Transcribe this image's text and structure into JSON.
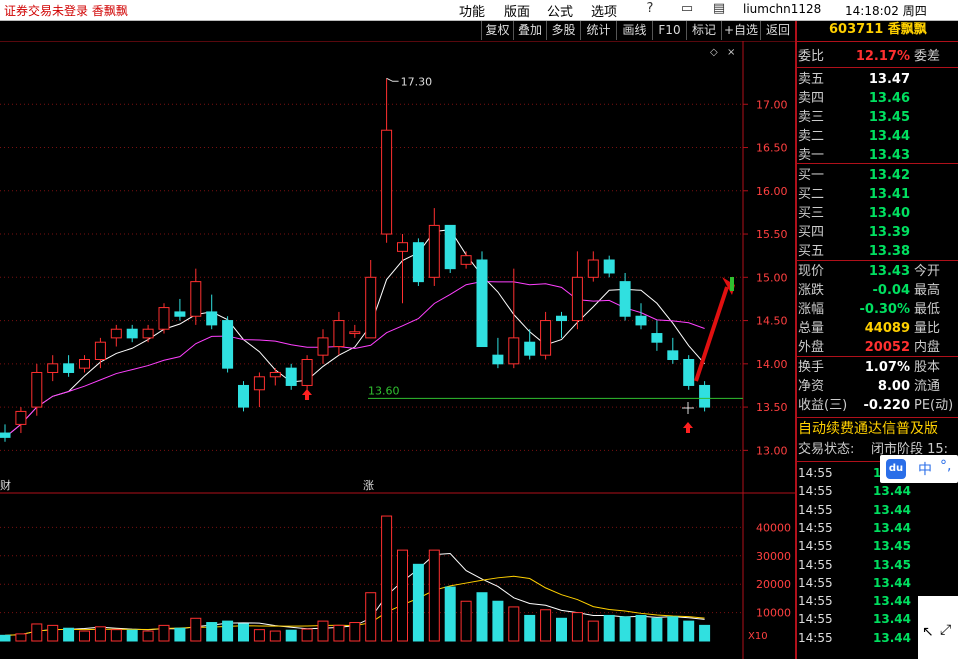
{
  "app": {
    "title": "证券交易未登录  香飘飘"
  },
  "menu": [
    "功能",
    "版面",
    "公式",
    "选项"
  ],
  "user": "liumchn1128",
  "clock": "14:18:02 周四",
  "toolbar": [
    "复权",
    "叠加",
    "多股",
    "统计",
    "画线",
    "F10",
    "标记",
    "+自选",
    "返回"
  ],
  "chart_data": {
    "type": "candlestick",
    "price_axis": {
      "ticks": [
        "17.00",
        "16.50",
        "16.00",
        "15.50",
        "15.00",
        "14.50",
        "14.00",
        "13.50",
        "13.00"
      ],
      "range": [
        12.9,
        17.5
      ]
    },
    "volume_axis": {
      "ticks": [
        "40000",
        "30000",
        "20000",
        "10000"
      ],
      "range": [
        0,
        50000
      ],
      "unit_label": "X10"
    },
    "annotations": {
      "high_label": "17.30",
      "support_label": "13.60",
      "marker_left": "财",
      "marker_mid": "涨"
    },
    "support_level": 13.6,
    "candles": [
      {
        "o": 13.2,
        "h": 13.3,
        "l": 13.1,
        "c": 13.15,
        "v": 2000
      },
      {
        "o": 13.3,
        "h": 13.5,
        "l": 13.2,
        "c": 13.45,
        "v": 2500
      },
      {
        "o": 13.5,
        "h": 14.0,
        "l": 13.4,
        "c": 13.9,
        "v": 6000
      },
      {
        "o": 13.9,
        "h": 14.1,
        "l": 13.8,
        "c": 14.0,
        "v": 5500
      },
      {
        "o": 14.0,
        "h": 14.1,
        "l": 13.85,
        "c": 13.9,
        "v": 4500
      },
      {
        "o": 13.95,
        "h": 14.1,
        "l": 13.9,
        "c": 14.05,
        "v": 3500
      },
      {
        "o": 14.05,
        "h": 14.3,
        "l": 13.95,
        "c": 14.25,
        "v": 5000
      },
      {
        "o": 14.3,
        "h": 14.45,
        "l": 14.2,
        "c": 14.4,
        "v": 4000
      },
      {
        "o": 14.4,
        "h": 14.45,
        "l": 14.25,
        "c": 14.3,
        "v": 3800
      },
      {
        "o": 14.3,
        "h": 14.45,
        "l": 14.25,
        "c": 14.4,
        "v": 3500
      },
      {
        "o": 14.4,
        "h": 14.7,
        "l": 14.35,
        "c": 14.65,
        "v": 5500
      },
      {
        "o": 14.6,
        "h": 14.75,
        "l": 14.5,
        "c": 14.55,
        "v": 4500
      },
      {
        "o": 14.55,
        "h": 15.1,
        "l": 14.45,
        "c": 14.95,
        "v": 8000
      },
      {
        "o": 14.6,
        "h": 14.8,
        "l": 14.4,
        "c": 14.45,
        "v": 6500
      },
      {
        "o": 14.5,
        "h": 14.55,
        "l": 13.9,
        "c": 13.95,
        "v": 7000
      },
      {
        "o": 13.75,
        "h": 13.8,
        "l": 13.45,
        "c": 13.5,
        "v": 6000
      },
      {
        "o": 13.7,
        "h": 13.9,
        "l": 13.5,
        "c": 13.85,
        "v": 4000
      },
      {
        "o": 13.85,
        "h": 13.95,
        "l": 13.75,
        "c": 13.9,
        "v": 3500
      },
      {
        "o": 13.95,
        "h": 14.0,
        "l": 13.7,
        "c": 13.75,
        "v": 3800
      },
      {
        "o": 13.75,
        "h": 14.1,
        "l": 13.7,
        "c": 14.05,
        "v": 4200
      },
      {
        "o": 14.1,
        "h": 14.4,
        "l": 14.0,
        "c": 14.3,
        "v": 7000
      },
      {
        "o": 14.2,
        "h": 14.6,
        "l": 14.1,
        "c": 14.5,
        "v": 5500
      },
      {
        "o": 14.35,
        "h": 14.45,
        "l": 14.3,
        "c": 14.37,
        "v": 6500
      },
      {
        "o": 14.3,
        "h": 15.2,
        "l": 14.3,
        "c": 15.0,
        "v": 17000
      },
      {
        "o": 15.5,
        "h": 17.3,
        "l": 15.4,
        "c": 16.7,
        "v": 44000
      },
      {
        "o": 15.3,
        "h": 15.5,
        "l": 14.7,
        "c": 15.4,
        "v": 32000
      },
      {
        "o": 15.4,
        "h": 15.45,
        "l": 14.9,
        "c": 14.95,
        "v": 27000
      },
      {
        "o": 15.0,
        "h": 15.8,
        "l": 14.9,
        "c": 15.6,
        "v": 32000
      },
      {
        "o": 15.6,
        "h": 15.6,
        "l": 15.05,
        "c": 15.1,
        "v": 19000
      },
      {
        "o": 15.15,
        "h": 15.3,
        "l": 15.1,
        "c": 15.25,
        "v": 14000
      },
      {
        "o": 15.2,
        "h": 15.3,
        "l": 14.3,
        "c": 14.2,
        "v": 17000
      },
      {
        "o": 14.1,
        "h": 14.3,
        "l": 13.95,
        "c": 14.0,
        "v": 14000
      },
      {
        "o": 14.0,
        "h": 15.1,
        "l": 13.95,
        "c": 14.3,
        "v": 12000
      },
      {
        "o": 14.25,
        "h": 14.4,
        "l": 14.05,
        "c": 14.1,
        "v": 9000
      },
      {
        "o": 14.1,
        "h": 14.6,
        "l": 14.05,
        "c": 14.5,
        "v": 11000
      },
      {
        "o": 14.55,
        "h": 14.6,
        "l": 14.3,
        "c": 14.5,
        "v": 8000
      },
      {
        "o": 14.5,
        "h": 15.3,
        "l": 14.4,
        "c": 15.0,
        "v": 10000
      },
      {
        "o": 15.0,
        "h": 15.3,
        "l": 14.95,
        "c": 15.2,
        "v": 7000
      },
      {
        "o": 15.2,
        "h": 15.25,
        "l": 15.0,
        "c": 15.05,
        "v": 9000
      },
      {
        "o": 14.95,
        "h": 15.05,
        "l": 14.5,
        "c": 14.55,
        "v": 8500
      },
      {
        "o": 14.55,
        "h": 14.7,
        "l": 14.4,
        "c": 14.45,
        "v": 9000
      },
      {
        "o": 14.35,
        "h": 14.5,
        "l": 14.15,
        "c": 14.25,
        "v": 8000
      },
      {
        "o": 14.15,
        "h": 14.3,
        "l": 14.0,
        "c": 14.05,
        "v": 8500
      },
      {
        "o": 14.05,
        "h": 14.1,
        "l": 13.7,
        "c": 13.75,
        "v": 7000
      },
      {
        "o": 13.75,
        "h": 13.8,
        "l": 13.45,
        "c": 13.5,
        "v": 5500
      }
    ]
  },
  "quote": {
    "code_name": "603711 香飘飘",
    "weibi": {
      "label": "委比",
      "value": "12.17%",
      "label2": "委差"
    },
    "asks": [
      {
        "label": "卖五",
        "price": "13.47"
      },
      {
        "label": "卖四",
        "price": "13.46"
      },
      {
        "label": "卖三",
        "price": "13.45"
      },
      {
        "label": "卖二",
        "price": "13.44"
      },
      {
        "label": "卖一",
        "price": "13.43"
      }
    ],
    "bids": [
      {
        "label": "买一",
        "price": "13.42"
      },
      {
        "label": "买二",
        "price": "13.41"
      },
      {
        "label": "买三",
        "price": "13.40"
      },
      {
        "label": "买四",
        "price": "13.39"
      },
      {
        "label": "买五",
        "price": "13.38"
      }
    ],
    "stats": [
      {
        "label": "现价",
        "value": "13.43",
        "label2": "今开"
      },
      {
        "label": "涨跌",
        "value": "-0.04",
        "label2": "最高"
      },
      {
        "label": "涨幅",
        "value": "-0.30%",
        "label2": "最低"
      },
      {
        "label": "总量",
        "value": "44089",
        "label2": "量比"
      },
      {
        "label": "外盘",
        "value": "20052",
        "label2": "内盘"
      }
    ],
    "stats2": [
      {
        "label": "换手",
        "value": "1.07%",
        "label2": "股本"
      },
      {
        "label": "净资",
        "value": "8.00",
        "label2": "流通"
      },
      {
        "label": "收益(三)",
        "value": "-0.220",
        "label2": "PE(动)"
      }
    ],
    "banner": "自动续费通达信普及版",
    "trade_status": "交易状态:",
    "trade_status_suffix": "闭市阶段 15:",
    "ticks": [
      {
        "time": "14:55",
        "price": "13.45"
      },
      {
        "time": "14:55",
        "price": "13.44"
      },
      {
        "time": "14:55",
        "price": "13.44"
      },
      {
        "time": "14:55",
        "price": "13.44"
      },
      {
        "time": "14:55",
        "price": "13.45"
      },
      {
        "time": "14:55",
        "price": "13.45"
      },
      {
        "time": "14:55",
        "price": "13.44"
      },
      {
        "time": "14:55",
        "price": "13.44"
      },
      {
        "time": "14:55",
        "price": "13.44"
      },
      {
        "time": "14:55",
        "price": "13.44"
      }
    ]
  },
  "ime": {
    "logo": "du",
    "lang": "中",
    "punct": "°,"
  },
  "colors": {
    "up": "#ff3030",
    "down": "#30e0e0",
    "ma5": "#ffffff",
    "ma10": "#ff40ff",
    "support": "#30c030",
    "axis": "#b0101a",
    "price_text": "#00e060"
  }
}
